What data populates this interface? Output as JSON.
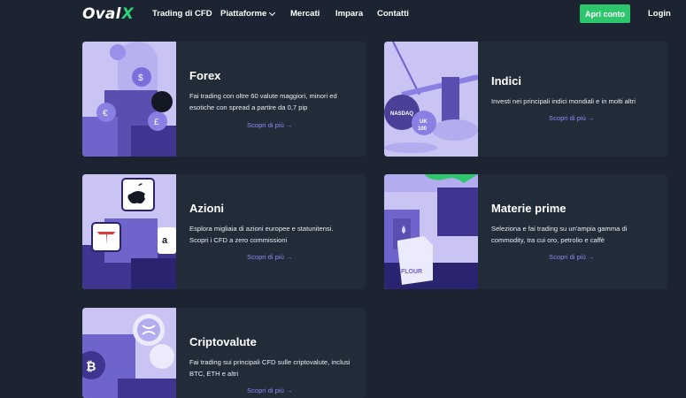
{
  "header": {
    "logo_text": "Oval",
    "logo_accent": "X",
    "nav": [
      {
        "label": "Trading di CFD"
      },
      {
        "label": "Piattaforme"
      },
      {
        "label": "Mercati"
      },
      {
        "label": "Impara"
      },
      {
        "label": "Contatti"
      }
    ],
    "open_account_label": "Apri conto",
    "login_label": "Login"
  },
  "cards": [
    {
      "title": "Forex",
      "description": "Fai trading con oltre 60 valute maggiori, minori ed esotiche con spread a partire da 0,7 pip",
      "link": "Scopri di più →"
    },
    {
      "title": "Indici",
      "description": "Investi nei principali indici mondiali e in molti altri",
      "link": "Scopri di più →",
      "illus_labels": [
        "NASDAQ",
        "UK",
        "100"
      ]
    },
    {
      "title": "Azioni",
      "description": "Esplora migliaia di azioni europee e statunitensi. Scopri i CFD a zero commissioni",
      "link": "Scopri di più →"
    },
    {
      "title": "Materie prime",
      "description": "Seleziona e fai trading su un'ampia gamma di commodity, tra cui oro, petrolio e caffè",
      "link": "Scopri di più →",
      "illus_labels": [
        "FLOUR"
      ]
    },
    {
      "title": "Criptovalute",
      "description": "Fai trading sui principali CFD sulle criptovalute, inclusi BTC, ETH e altri",
      "link": "Scopri di più →"
    }
  ],
  "colors": {
    "background": "#1b2430",
    "card": "#222c38",
    "accent_green": "#2dc66d",
    "link": "#8a8cf6",
    "illustration_purple": "#c9c4f4"
  },
  "icons": [
    "chevron-down-icon",
    "arrow-right-icon",
    "apple-logo-icon",
    "tesla-logo-icon",
    "amazon-logo-icon",
    "bitcoin-icon",
    "ripple-icon",
    "coin-icon"
  ]
}
